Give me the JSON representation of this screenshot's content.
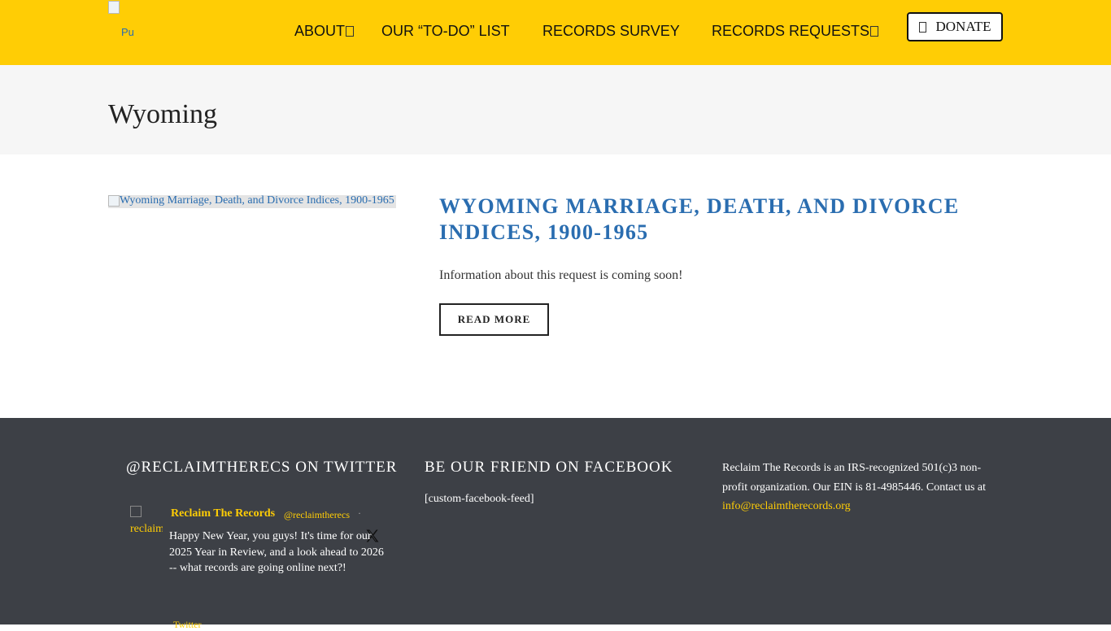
{
  "header": {
    "logo_alt": "Pu",
    "nav": [
      {
        "label": "ABOUT",
        "has_dropdown": true
      },
      {
        "label": "OUR “TO-DO” LIST",
        "has_dropdown": false
      },
      {
        "label": "RECORDS SURVEY",
        "has_dropdown": false
      },
      {
        "label": "RECORDS REQUESTS",
        "has_dropdown": true
      }
    ],
    "donate_label": "DONATE",
    "background_color": "#ffcd05"
  },
  "page": {
    "title": "Wyoming"
  },
  "post": {
    "image_alt": "Wyoming Marriage, Death, and Divorce Indices, 1900-1965",
    "title": "WYOMING MARRIAGE, DEATH, AND DIVORCE INDICES, 1900-1965",
    "excerpt": "Information about this request is coming soon!",
    "read_more_label": "READ MORE",
    "title_color": "#2a6db0"
  },
  "footer": {
    "background_color": "#3d4046",
    "twitter": {
      "heading": "@RECLAIMTHERECS ON TWITTER",
      "avatar_alt": "reclaimth",
      "name": "Reclaim The Records",
      "handle": "@reclaimtherecs",
      "separator": "·",
      "text": "Happy New Year, you guys! It's time for our 2025 Year in Review, and a look ahead to 2026 -- what records are going online next?!",
      "link_label": "Twitter"
    },
    "facebook": {
      "heading": "BE OUR FRIEND ON FACEBOOK",
      "feed_placeholder": "[custom-facebook-feed]"
    },
    "about": {
      "text": "Reclaim The Records is an IRS-recognized 501(c)3 non-profit organization. Our EIN is 81-4985446. Contact us at ",
      "email": "info@reclaimtherecords.org"
    }
  }
}
